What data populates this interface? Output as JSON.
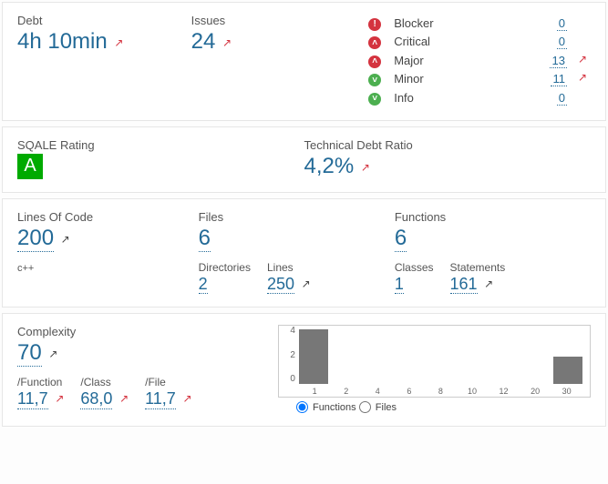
{
  "debt_issues": {
    "debt_label": "Debt",
    "debt_value": "4h 10min",
    "issues_label": "Issues",
    "issues_value": "24",
    "severities": [
      {
        "id": "blocker",
        "label": "Blocker",
        "count": "0",
        "trend": false
      },
      {
        "id": "critical",
        "label": "Critical",
        "count": "0",
        "trend": false
      },
      {
        "id": "major",
        "label": "Major",
        "count": "13",
        "trend": true
      },
      {
        "id": "minor",
        "label": "Minor",
        "count": "11",
        "trend": true
      },
      {
        "id": "info",
        "label": "Info",
        "count": "0",
        "trend": false
      }
    ]
  },
  "sqale": {
    "rating_label": "SQALE Rating",
    "rating_grade": "A",
    "ratio_label": "Technical Debt Ratio",
    "ratio_value": "4,2%"
  },
  "size": {
    "loc_label": "Lines Of Code",
    "loc_value": "200",
    "language": "c++",
    "files_label": "Files",
    "files_value": "6",
    "dirs_label": "Directories",
    "dirs_value": "2",
    "lines_label": "Lines",
    "lines_value": "250",
    "functions_label": "Functions",
    "functions_value": "6",
    "classes_label": "Classes",
    "classes_value": "1",
    "stmts_label": "Statements",
    "stmts_value": "161"
  },
  "complexity": {
    "label": "Complexity",
    "value": "70",
    "per_function_label": "/Function",
    "per_function_value": "11,7",
    "per_class_label": "/Class",
    "per_class_value": "68,0",
    "per_file_label": "/File",
    "per_file_value": "11,7",
    "radio_functions": "Functions",
    "radio_files": "Files"
  },
  "chart_data": {
    "type": "bar",
    "categories": [
      "1",
      "2",
      "4",
      "6",
      "8",
      "10",
      "12",
      "20",
      "30"
    ],
    "values": [
      4,
      0,
      0,
      0,
      0,
      0,
      0,
      0,
      2
    ],
    "xlabel": "",
    "ylabel": "",
    "ylim": [
      0,
      4
    ],
    "yticks": [
      "0",
      "2",
      "4"
    ]
  }
}
